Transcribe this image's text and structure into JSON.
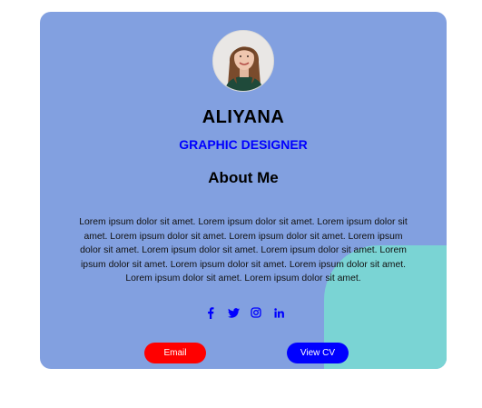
{
  "profile": {
    "name": "ALIYANA",
    "title": "GRAPHIC DESIGNER",
    "section_heading": "About Me",
    "bio": "Lorem ipsum dolor sit amet. Lorem ipsum dolor sit amet. Lorem ipsum dolor sit amet. Lorem ipsum dolor sit amet. Lorem ipsum dolor sit amet. Lorem ipsum dolor sit amet. Lorem ipsum dolor sit amet. Lorem ipsum dolor sit amet. Lorem ipsum dolor sit amet. Lorem ipsum dolor sit amet. Lorem ipsum dolor sit amet. Lorem ipsum dolor sit amet. Lorem ipsum dolor sit amet."
  },
  "socials": [
    {
      "icon": "facebook-icon"
    },
    {
      "icon": "twitter-icon"
    },
    {
      "icon": "instagram-icon"
    },
    {
      "icon": "linkedin-icon"
    }
  ],
  "buttons": {
    "email_label": "Email",
    "cv_label": "View CV"
  },
  "colors": {
    "card_background": "#82a0e0",
    "accent_blob": "#7ad4d4",
    "title_color": "#0000ff",
    "email_button": "#ff0000",
    "cv_button": "#0000ff"
  }
}
